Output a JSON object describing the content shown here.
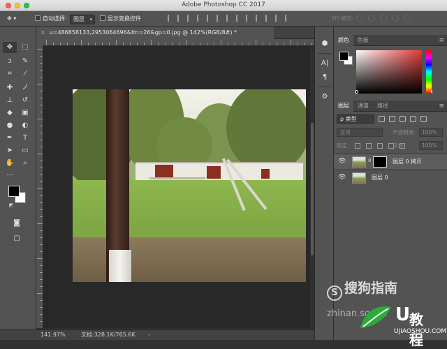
{
  "window": {
    "title": "Adobe Photoshop CC 2017"
  },
  "options_bar": {
    "auto_select_label": "自动选择:",
    "auto_select_value": "图层",
    "show_transform_label": "显示变换控件",
    "mode_3d_label": "3D 模式:"
  },
  "document": {
    "tab_title": "u=486858133,2953064696&fm=26&gp=0.jpg @ 142%(RGB/8#) *",
    "close_glyph": "×"
  },
  "status": {
    "zoom": "141.97%",
    "doc_size": "文档:328.1K/765.6K",
    "arrow": "›"
  },
  "color_panel": {
    "tabs": [
      "颜色",
      "色板"
    ],
    "colors": {
      "foreground": "#000000",
      "background": "#ffffff",
      "hue": "#e53838"
    }
  },
  "layers_panel": {
    "tabs": [
      "图层",
      "通道",
      "路径"
    ],
    "kind_filter": "ρ 类型",
    "blend_mode": "正常",
    "opacity_label": "不透明度:",
    "opacity_value": "100%",
    "lock_label": "锁定:",
    "fill_label": "填充:",
    "fill_value": "100%",
    "layers": [
      {
        "name": "图层 0 拷贝",
        "visible": true,
        "has_mask": true,
        "link_glyph": "8"
      },
      {
        "name": "图层 0",
        "visible": true,
        "has_mask": false
      }
    ]
  },
  "panel_menu_glyph": "≡",
  "watermarks": {
    "sogou_logo": "S",
    "sogou_text": "搜狗指南",
    "sogou_url": "zhinan.sogou",
    "ujiao_u": "U",
    "ujiao_text": "教程",
    "ujiao_url": "UJIAOSHOU.COM"
  },
  "icons": {
    "move": "move-icon",
    "marquee": "marquee-icon",
    "lasso": "lasso-icon",
    "quick_select": "quick-select-icon",
    "crop": "crop-icon",
    "eyedropper": "eyedropper-icon",
    "healing": "healing-brush-icon",
    "brush": "brush-icon",
    "stamp": "clone-stamp-icon",
    "history_brush": "history-brush-icon",
    "eraser": "eraser-icon",
    "gradient": "gradient-icon",
    "blur": "blur-icon",
    "dodge": "dodge-icon",
    "pen": "pen-icon",
    "type": "type-icon",
    "path_select": "path-selection-icon",
    "shape": "rectangle-shape-icon",
    "hand": "hand-icon",
    "zoom": "zoom-icon",
    "more": "more-tools-icon"
  },
  "dock_glyphs": {
    "navigator": "⬢",
    "character": "A|",
    "paragraph": "¶",
    "properties": "⚙"
  },
  "eye_glyph": "👁"
}
